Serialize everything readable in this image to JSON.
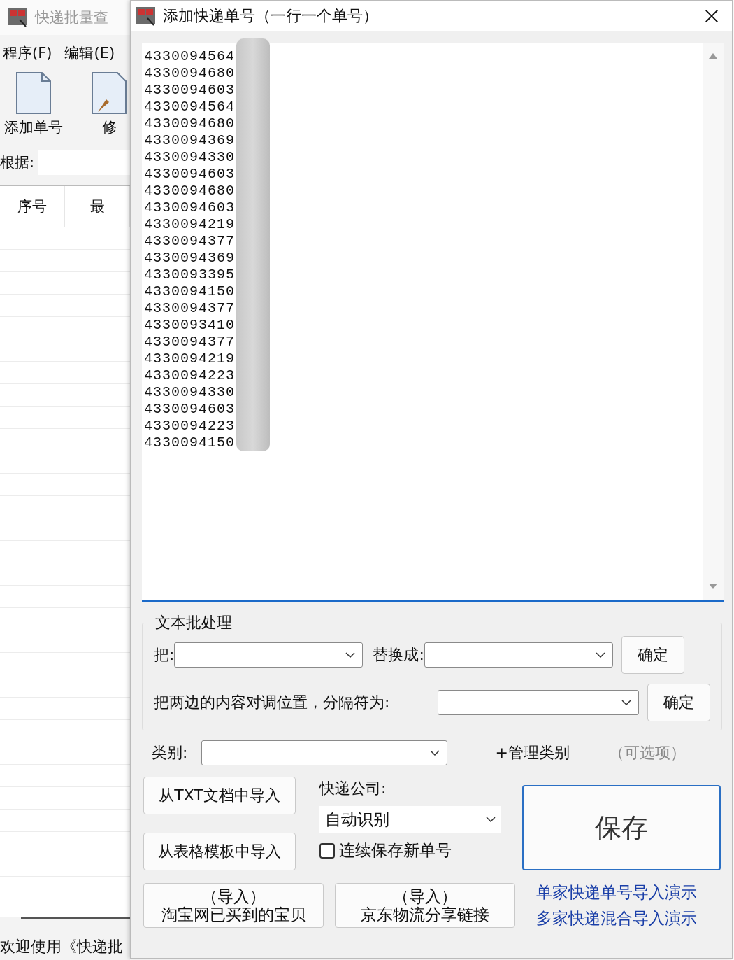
{
  "main_window": {
    "title": "快递批量查",
    "menu": [
      "程序(F)",
      "编辑(E)"
    ],
    "toolbar": [
      "添加单号",
      "修"
    ],
    "filter_label": "根据:",
    "columns": [
      "序号",
      "最"
    ],
    "status": "欢迎使用《快递批"
  },
  "dialog": {
    "title": "添加快递单号（一行一个单号）",
    "numbers": [
      "4330094564",
      "4330094680",
      "4330094603",
      "4330094564",
      "4330094680",
      "4330094369",
      "4330094330",
      "4330094603",
      "4330094680",
      "4330094603",
      "4330094219",
      "4330094377",
      "4330094369",
      "4330093395",
      "4330094150",
      "4330094377",
      "4330093410",
      "4330094377",
      "4330094219",
      "4330094223",
      "4330094330",
      "4330094603",
      "4330094223",
      "4330094150"
    ],
    "batch": {
      "title": "文本批处理",
      "replace_label": "把:",
      "with_label": "替换成:",
      "confirm": "确定",
      "swap_label": "把两边的内容对调位置，分隔符为:",
      "swap_confirm": "确定"
    },
    "category_label": "类别:",
    "manage": "+管理类别",
    "optional": "（可选项）",
    "import_txt": "从TXT文档中导入",
    "import_sheet": "从表格模板中导入",
    "courier_label": "快递公司:",
    "courier_value": "自动识别",
    "continuous": {
      "label": "连续保存新单号",
      "checked": false
    },
    "save": "保存",
    "taobao": [
      "（导入）",
      "淘宝网已买到的宝贝"
    ],
    "jd": [
      "（导入）",
      "京东物流分享链接"
    ],
    "links": [
      "单家快递单号导入演示",
      "多家快递混合导入演示"
    ]
  }
}
